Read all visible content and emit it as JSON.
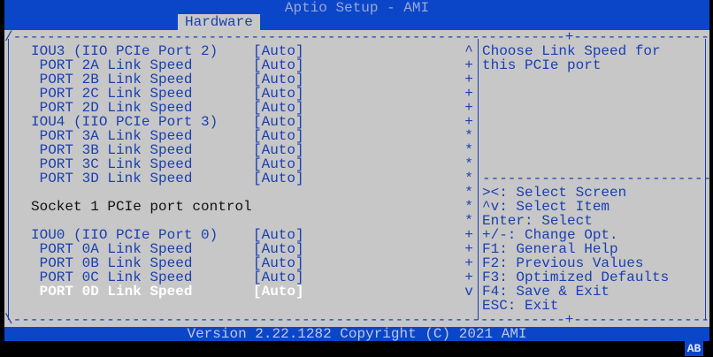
{
  "header": {
    "title": "Aptio Setup - AMI",
    "tab": "Hardware"
  },
  "frame": {
    "top": "/-----------------------------------------------------------------+------------------------------\\",
    "bottom": "\\-----------------------------------------------------------------+------------------------------/",
    "help_divider": "------------------------------"
  },
  "menu": [
    {
      "label": "IOU3 (IIO PCIe Port 2)",
      "value": "[Auto]",
      "marker": "^",
      "indent": false,
      "selected": false,
      "plain": false
    },
    {
      "label": " PORT 2A Link Speed",
      "value": "[Auto]",
      "marker": "+",
      "indent": true,
      "selected": false,
      "plain": false
    },
    {
      "label": " PORT 2B Link Speed",
      "value": "[Auto]",
      "marker": "+",
      "indent": true,
      "selected": false,
      "plain": false
    },
    {
      "label": " PORT 2C Link Speed",
      "value": "[Auto]",
      "marker": "+",
      "indent": true,
      "selected": false,
      "plain": false
    },
    {
      "label": " PORT 2D Link Speed",
      "value": "[Auto]",
      "marker": "+",
      "indent": true,
      "selected": false,
      "plain": false
    },
    {
      "label": "IOU4 (IIO PCIe Port 3)",
      "value": "[Auto]",
      "marker": "+",
      "indent": false,
      "selected": false,
      "plain": false
    },
    {
      "label": " PORT 3A Link Speed",
      "value": "[Auto]",
      "marker": "*",
      "indent": true,
      "selected": false,
      "plain": false
    },
    {
      "label": " PORT 3B Link Speed",
      "value": "[Auto]",
      "marker": "*",
      "indent": true,
      "selected": false,
      "plain": false
    },
    {
      "label": " PORT 3C Link Speed",
      "value": "[Auto]",
      "marker": "*",
      "indent": true,
      "selected": false,
      "plain": false
    },
    {
      "label": " PORT 3D Link Speed",
      "value": "[Auto]",
      "marker": "*",
      "indent": true,
      "selected": false,
      "plain": false
    },
    {
      "label": "",
      "value": "",
      "marker": "*",
      "indent": false,
      "selected": false,
      "plain": false
    },
    {
      "label": "Socket 1 PCIe port control",
      "value": "",
      "marker": "*",
      "indent": false,
      "selected": false,
      "plain": true
    },
    {
      "label": "",
      "value": "",
      "marker": "*",
      "indent": false,
      "selected": false,
      "plain": false
    },
    {
      "label": "IOU0 (IIO PCIe Port 0)",
      "value": "[Auto]",
      "marker": "+",
      "indent": false,
      "selected": false,
      "plain": false
    },
    {
      "label": " PORT 0A Link Speed",
      "value": "[Auto]",
      "marker": "+",
      "indent": true,
      "selected": false,
      "plain": false
    },
    {
      "label": " PORT 0B Link Speed",
      "value": "[Auto]",
      "marker": "+",
      "indent": true,
      "selected": false,
      "plain": false
    },
    {
      "label": " PORT 0C Link Speed",
      "value": "[Auto]",
      "marker": "+",
      "indent": true,
      "selected": false,
      "plain": false
    },
    {
      "label": " PORT 0D Link Speed",
      "value": "[Auto]",
      "marker": "v",
      "indent": true,
      "selected": true,
      "plain": false
    }
  ],
  "help": {
    "description": [
      "Choose Link Speed for",
      "this PCIe port"
    ],
    "keys": [
      "><: Select Screen",
      "^v: Select Item",
      "Enter: Select",
      "+/-: Change Opt.",
      "F1: General Help",
      "F2: Previous Values",
      "F3: Optimized Defaults",
      "F4: Save & Exit",
      "ESC: Exit"
    ]
  },
  "footer": {
    "version": "Version 2.22.1282 Copyright (C) 2021 AMI",
    "badge": "AB"
  }
}
